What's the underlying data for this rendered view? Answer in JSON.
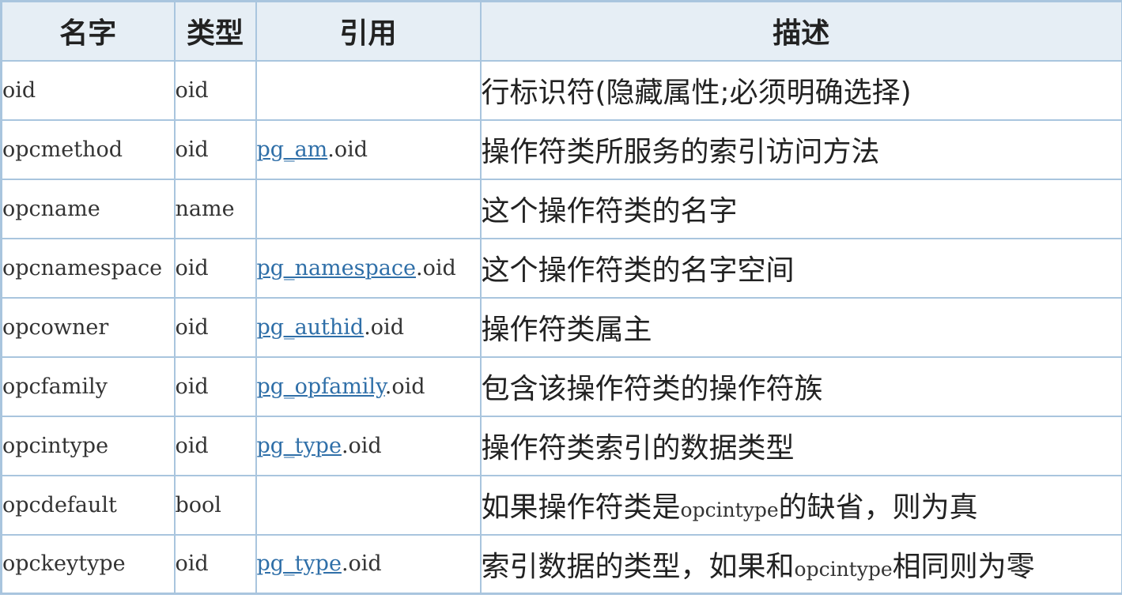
{
  "table": {
    "headers": {
      "name": "名字",
      "type": "类型",
      "ref": "引用",
      "desc": "描述"
    },
    "rows": [
      {
        "name": "oid",
        "type": "oid",
        "ref_link": "",
        "ref_suffix": "",
        "desc_pre": "行标识符(隐藏属性;必须明确选择)",
        "desc_code": "",
        "desc_post": ""
      },
      {
        "name": "opcmethod",
        "type": "oid",
        "ref_link": "pg_am",
        "ref_suffix": ".oid",
        "desc_pre": "操作符类所服务的索引访问方法",
        "desc_code": "",
        "desc_post": ""
      },
      {
        "name": "opcname",
        "type": "name",
        "ref_link": "",
        "ref_suffix": "",
        "desc_pre": "这个操作符类的名字",
        "desc_code": "",
        "desc_post": ""
      },
      {
        "name": "opcnamespace",
        "type": "oid",
        "ref_link": "pg_namespace",
        "ref_suffix": ".oid",
        "desc_pre": "这个操作符类的名字空间",
        "desc_code": "",
        "desc_post": ""
      },
      {
        "name": "opcowner",
        "type": "oid",
        "ref_link": "pg_authid",
        "ref_suffix": ".oid",
        "desc_pre": "操作符类属主",
        "desc_code": "",
        "desc_post": ""
      },
      {
        "name": "opcfamily",
        "type": "oid",
        "ref_link": "pg_opfamily",
        "ref_suffix": ".oid",
        "desc_pre": "包含该操作符类的操作符族",
        "desc_code": "",
        "desc_post": ""
      },
      {
        "name": "opcintype",
        "type": "oid",
        "ref_link": "pg_type",
        "ref_suffix": ".oid",
        "desc_pre": "操作符类索引的数据类型",
        "desc_code": "",
        "desc_post": ""
      },
      {
        "name": "opcdefault",
        "type": "bool",
        "ref_link": "",
        "ref_suffix": "",
        "desc_pre": "如果操作符类是",
        "desc_code": "opcintype",
        "desc_post": "的缺省，则为真"
      },
      {
        "name": "opckeytype",
        "type": "oid",
        "ref_link": "pg_type",
        "ref_suffix": ".oid",
        "desc_pre": "索引数据的类型，如果和",
        "desc_code": "opcintype",
        "desc_post": "相同则为零"
      }
    ]
  }
}
